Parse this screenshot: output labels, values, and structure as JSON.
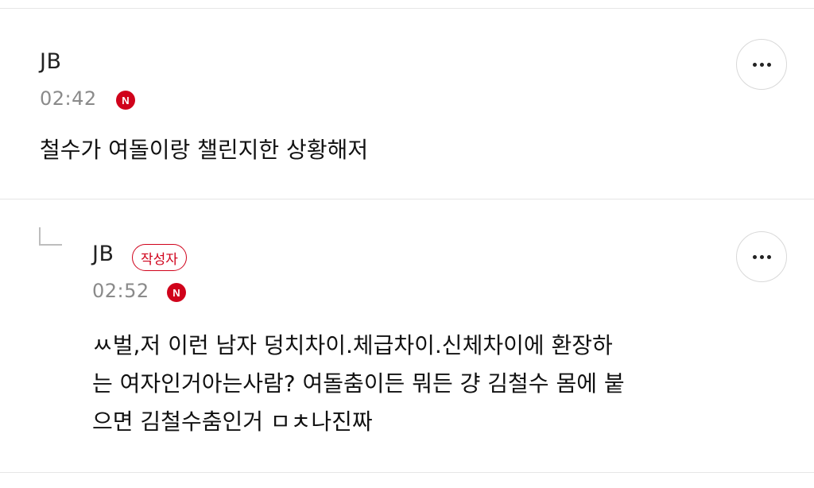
{
  "comments": [
    {
      "author": "JB",
      "time": "02:42",
      "badge": "N",
      "text": "철수가 여돌이랑 챌린지한 상황해저"
    },
    {
      "author": "JB",
      "author_badge": "작성자",
      "time": "02:52",
      "badge": "N",
      "text_lines": [
        "ㅆ벌,저 이런 남자 덩치차이.체급차이.신체차이에 환장하",
        "는 여자인거아는사람? 여돌춤이든 뭐든 걍 김철수 몸에 붙",
        "으면 김철수춤인거 ㅁㅊ나진짜"
      ]
    }
  ],
  "colors": {
    "badge_red": "#d0021b",
    "divider": "#e6e6e6",
    "meta_gray": "#8a8a8a"
  },
  "icons": {
    "more": "more-horizontal-icon",
    "reply": "reply-arrow-icon"
  }
}
